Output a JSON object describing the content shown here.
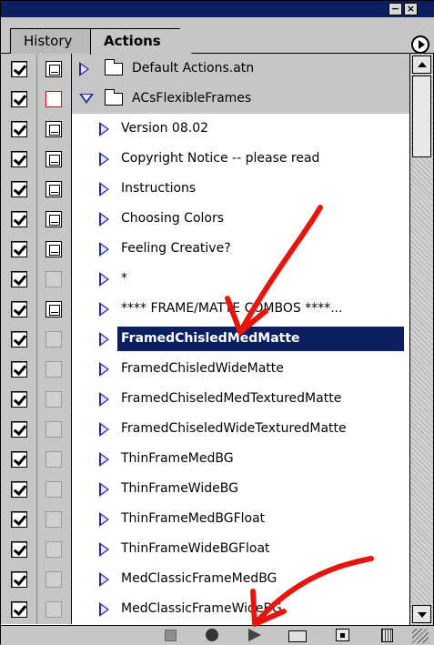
{
  "window": {
    "minimize_label": "−",
    "close_label": "×"
  },
  "tabs": {
    "history": "History",
    "actions": "Actions"
  },
  "rows": [
    {
      "label": "Default Actions.atn",
      "kind": "set",
      "expanded": false,
      "dialog": "on",
      "checked": true
    },
    {
      "label": "ACsFlexibleFrames",
      "kind": "set",
      "expanded": true,
      "dialog": "red",
      "checked": true
    },
    {
      "label": "Version 08.02",
      "kind": "action",
      "dialog": "on",
      "checked": true
    },
    {
      "label": "Copyright Notice -- please read",
      "kind": "action",
      "dialog": "on",
      "checked": true
    },
    {
      "label": "Instructions",
      "kind": "action",
      "dialog": "on",
      "checked": true
    },
    {
      "label": "Choosing Colors",
      "kind": "action",
      "dialog": "on",
      "checked": true
    },
    {
      "label": "Feeling Creative?",
      "kind": "action",
      "dialog": "on",
      "checked": true
    },
    {
      "label": "*",
      "kind": "action",
      "dialog": "empty",
      "checked": true
    },
    {
      "label": "****  FRAME/MATTE COMBOS ****...",
      "kind": "action",
      "dialog": "on",
      "checked": true
    },
    {
      "label": "FramedChisledMedMatte",
      "kind": "action",
      "dialog": "empty",
      "checked": true,
      "selected": true
    },
    {
      "label": "FramedChisledWideMatte",
      "kind": "action",
      "dialog": "empty",
      "checked": true
    },
    {
      "label": "FramedChiseledMedTexturedMatte",
      "kind": "action",
      "dialog": "empty",
      "checked": true
    },
    {
      "label": "FramedChiseledWideTexturedMatte",
      "kind": "action",
      "dialog": "empty",
      "checked": true
    },
    {
      "label": "ThinFrameMedBG",
      "kind": "action",
      "dialog": "empty",
      "checked": true
    },
    {
      "label": "ThinFrameWideBG",
      "kind": "action",
      "dialog": "empty",
      "checked": true
    },
    {
      "label": "ThinFrameMedBGFloat",
      "kind": "action",
      "dialog": "empty",
      "checked": true
    },
    {
      "label": "ThinFrameWideBGFloat",
      "kind": "action",
      "dialog": "empty",
      "checked": true
    },
    {
      "label": "MedClassicFrameMedBG",
      "kind": "action",
      "dialog": "empty",
      "checked": true
    },
    {
      "label": "MedClassicFrameWideBG",
      "kind": "action",
      "dialog": "empty",
      "checked": true
    }
  ],
  "toolbar": {
    "icons": [
      "stop-icon",
      "record-icon",
      "play-icon",
      "new-set-icon",
      "new-action-icon",
      "trash-icon"
    ]
  },
  "colors": {
    "selection": "#0d1f63",
    "annotation": "#e8150c",
    "triangle": "#2a2a9a"
  }
}
